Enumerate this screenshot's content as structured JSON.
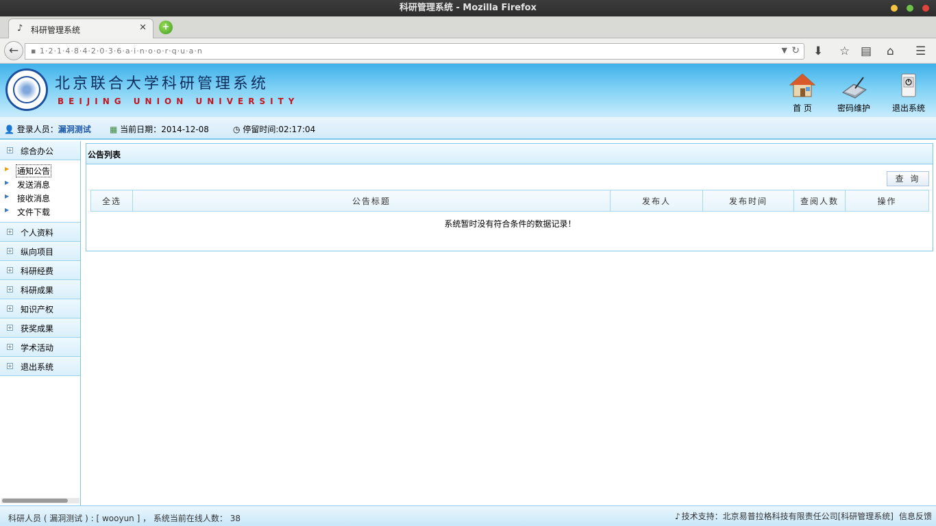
{
  "window": {
    "title": "科研管理系统 - Mozilla Firefox",
    "dots": [
      "#f5c542",
      "#6fc24a",
      "#e0443a"
    ]
  },
  "browser": {
    "tab_title": "科研管理系统",
    "tab_close": "✕",
    "new_tab_glyph": "+",
    "url": "▪ 1·2·1·4·8·4·2·0·3·6·a·i·n·o·o·r·q·u·a·n",
    "back_glyph": "←",
    "icons": [
      "download-icon",
      "bookmark-star-icon",
      "reading-list-icon",
      "home-icon",
      "menu-icon"
    ]
  },
  "header": {
    "system_title": "北京联合大学科研管理系统",
    "subtitle": "BEIJING UNION UNIVERSITY",
    "buttons": [
      {
        "label": "首 页",
        "icon": "house-icon"
      },
      {
        "label": "密码维护",
        "icon": "password-pad-icon"
      },
      {
        "label": "退出系统",
        "icon": "power-switch-icon"
      }
    ]
  },
  "infobar": {
    "login_label": "登录人员：",
    "login_user": "漏洞测试",
    "date_label": "当前日期：",
    "date_value": "2014-12-08",
    "stay_label": "停留时间:",
    "stay_value": "02:17:04"
  },
  "sidebar": {
    "sections": [
      {
        "label": "综合办公"
      },
      {
        "label": "个人资料"
      },
      {
        "label": "纵向项目"
      },
      {
        "label": "科研经费"
      },
      {
        "label": "科研成果"
      },
      {
        "label": "知识产权"
      },
      {
        "label": "获奖成果"
      },
      {
        "label": "学术活动"
      },
      {
        "label": "退出系统"
      }
    ],
    "office_items": [
      "通知公告",
      "发送消息",
      "接收消息",
      "文件下载"
    ],
    "active_item": "通知公告"
  },
  "main": {
    "panel_title": "公告列表",
    "query_button": "查 询",
    "columns": [
      "全选",
      "公告标题",
      "发布人",
      "发布时间",
      "查阅人数",
      "操作"
    ],
    "empty_message": "系统暂时没有符合条件的数据记录！"
  },
  "footer": {
    "left_text": "科研人员 ( 漏洞测试 ) : [ wooyun ]  ，  系统当前在线人数： 38",
    "support_text": "技术支持：北京易普拉格科技有限责任公司[科研管理系统]",
    "feedback_link": "信息反馈"
  }
}
